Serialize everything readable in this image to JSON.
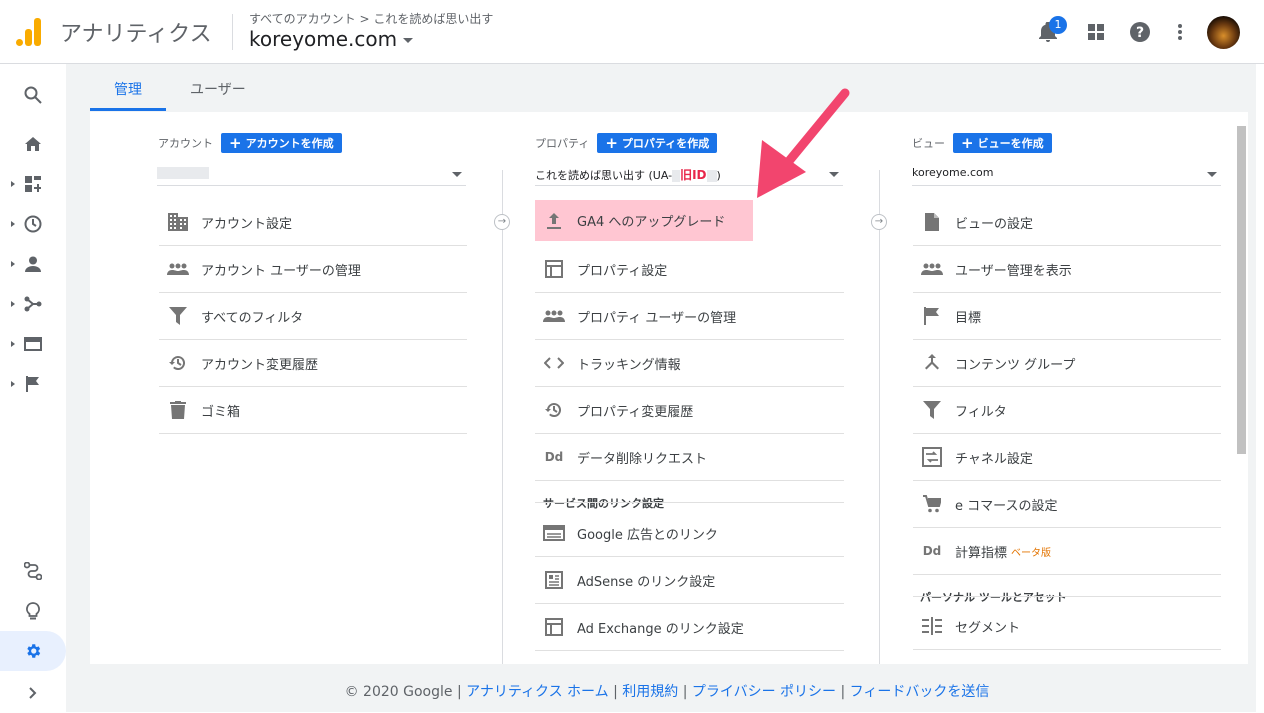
{
  "header": {
    "app_title": "アナリティクス",
    "breadcrumb": "すべてのアカウント > これを読めば思い出す",
    "property_name": "koreyome.com",
    "notification_count": "1"
  },
  "tabs": [
    {
      "label": "管理",
      "active": true
    },
    {
      "label": "ユーザー",
      "active": false
    }
  ],
  "account": {
    "header_label": "アカウント",
    "create_label": "アカウントを作成",
    "items": [
      {
        "label": "アカウント設定",
        "icon": "building-icon"
      },
      {
        "label": "アカウント ユーザーの管理",
        "icon": "people-icon"
      },
      {
        "label": "すべてのフィルタ",
        "icon": "filter-icon"
      },
      {
        "label": "アカウント変更履歴",
        "icon": "history-icon"
      },
      {
        "label": "ゴミ箱",
        "icon": "trash-icon"
      }
    ]
  },
  "property": {
    "header_label": "プロパティ",
    "create_label": "プロパティを作成",
    "selected_prefix": "これを読めば思い出す (UA-",
    "selected_tag": "旧ID",
    "selected_suffix": ")",
    "items": [
      {
        "label": "GA4 へのアップグレード",
        "icon": "upload-icon",
        "highlight": true
      },
      {
        "label": "プロパティ設定",
        "icon": "window-icon"
      },
      {
        "label": "プロパティ ユーザーの管理",
        "icon": "people-icon"
      },
      {
        "label": "トラッキング情報",
        "icon": "code-icon"
      },
      {
        "label": "プロパティ変更履歴",
        "icon": "history-icon"
      },
      {
        "label": "データ削除リクエスト",
        "icon": "dd-icon",
        "glyph": "Dd"
      }
    ],
    "section_label": "サービス間のリンク設定",
    "link_items": [
      {
        "label": "Google 広告とのリンク",
        "icon": "ads-icon"
      },
      {
        "label": "AdSense のリンク設定",
        "icon": "adsense-icon"
      },
      {
        "label": "Ad Exchange のリンク設定",
        "icon": "window-icon"
      }
    ]
  },
  "view": {
    "header_label": "ビュー",
    "create_label": "ビューを作成",
    "selected": "koreyome.com",
    "items": [
      {
        "label": "ビューの設定",
        "icon": "document-icon"
      },
      {
        "label": "ユーザー管理を表示",
        "icon": "people-icon"
      },
      {
        "label": "目標",
        "icon": "flag-icon"
      },
      {
        "label": "コンテンツ グループ",
        "icon": "merge-icon"
      },
      {
        "label": "フィルタ",
        "icon": "filter-icon"
      },
      {
        "label": "チャネル設定",
        "icon": "channel-icon"
      },
      {
        "label": "e コマースの設定",
        "icon": "cart-icon"
      },
      {
        "label": "計算指標",
        "icon": "dd-icon",
        "glyph": "Dd",
        "badge": "ベータ版"
      }
    ],
    "section_label": "パーソナル ツールとアセット",
    "tool_items": [
      {
        "label": "セグメント",
        "icon": "segment-icon"
      }
    ]
  },
  "footer": {
    "copyright": "© 2020 Google",
    "separator": " | ",
    "links": [
      "アナリティクス ホーム",
      "利用規約",
      "プライバシー ポリシー",
      "フィードバックを送信"
    ]
  },
  "colors": {
    "accent": "#1a73e8",
    "highlight": "#ffc6d2",
    "arrow": "#f2456e",
    "logo": "#f9ab00"
  }
}
